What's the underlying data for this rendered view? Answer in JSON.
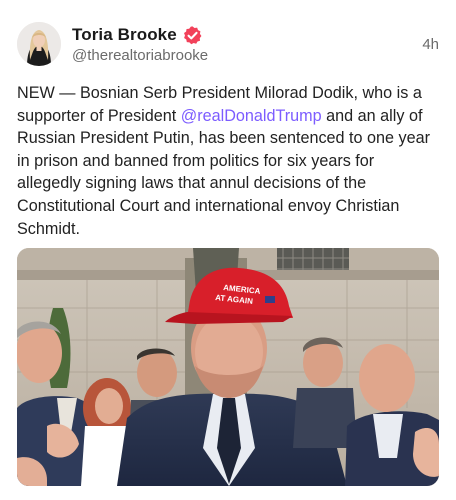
{
  "post": {
    "author": {
      "display_name": "Toria Brooke",
      "handle": "@therealtoriabrooke",
      "verified": true,
      "avatar_icon": "avatar-photo"
    },
    "timestamp": "4h",
    "text": {
      "part1": "NEW — Bosnian Serb President Milorad Dodik, who is a supporter of President ",
      "mention": "@realDonaldTrump",
      "part2": " and an ally of Russian President Putin, has been sentenced to one year in prison and banned from politics for six years for allegedly signing laws that annul decisions of the Constitutional Court and international envoy Christian Schmidt."
    },
    "media": {
      "hat_text_line1": "AMERICA",
      "hat_text_line2": "AT AGAIN"
    }
  },
  "colors": {
    "mention": "#7c5cff",
    "verified_badge": "#f2415a",
    "hat": "#d81f2a"
  }
}
